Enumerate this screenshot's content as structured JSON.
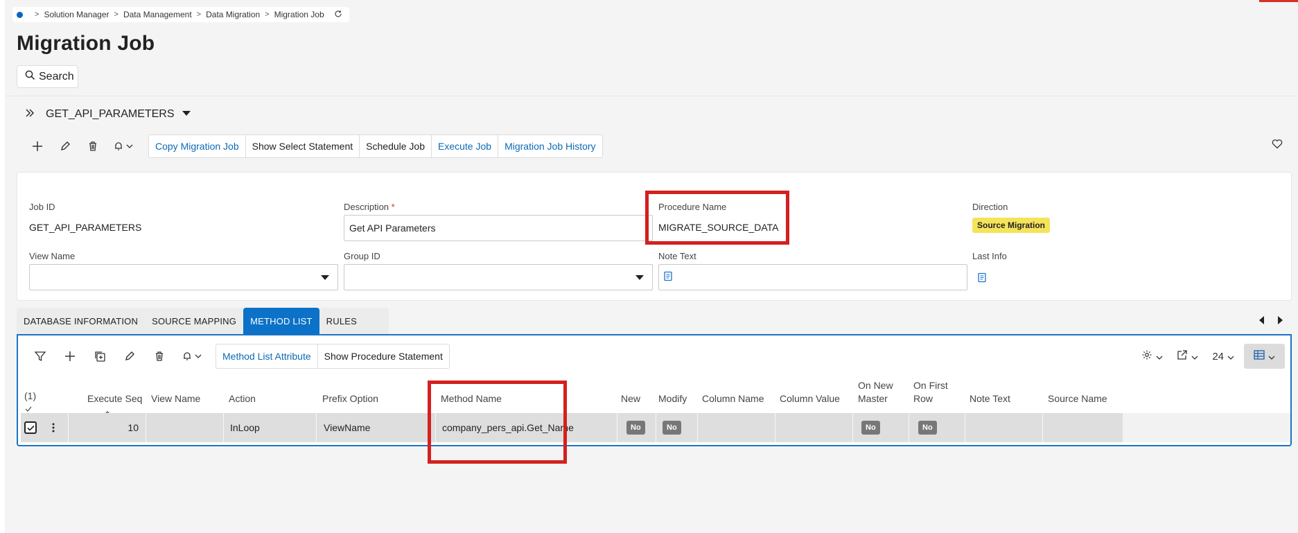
{
  "breadcrumb": {
    "items": [
      "Solution Manager",
      "Data Management",
      "Data Migration",
      "Migration Job"
    ],
    "separator": ">"
  },
  "page": {
    "title": "Migration Job",
    "search_label": "Search"
  },
  "record": {
    "title": "GET_API_PARAMETERS"
  },
  "toolbar": {
    "buttons": [
      "Copy Migration Job",
      "Show Select Statement",
      "Schedule Job",
      "Execute Job",
      "Migration Job History"
    ]
  },
  "form": {
    "job_id_label": "Job ID",
    "job_id_value": "GET_API_PARAMETERS",
    "description_label": "Description",
    "description_required": "*",
    "description_value": "Get API Parameters",
    "procedure_name_label": "Procedure Name",
    "procedure_name_value": "MIGRATE_SOURCE_DATA",
    "direction_label": "Direction",
    "direction_value": "Source Migration",
    "view_name_label": "View Name",
    "group_id_label": "Group ID",
    "note_text_label": "Note Text",
    "last_info_label": "Last Info"
  },
  "tabs": [
    {
      "label": "DATABASE INFORMATION",
      "active": false
    },
    {
      "label": "SOURCE MAPPING",
      "active": false
    },
    {
      "label": "METHOD LIST",
      "active": true
    },
    {
      "label": "RULES",
      "active": false
    }
  ],
  "method_toolbar": {
    "buttons": [
      "Method List Attribute",
      "Show Procedure Statement"
    ],
    "page_size": "24"
  },
  "table": {
    "selection_count": "(1)",
    "columns": [
      "Execute Seq",
      "View Name",
      "Action",
      "Prefix Option",
      "Method Name",
      "New",
      "Modify",
      "Column Name",
      "Column Value",
      "On New Master",
      "On First Row",
      "Note Text",
      "Source Name"
    ],
    "rows": [
      {
        "execute_seq": "10",
        "view_name": "",
        "action": "InLoop",
        "prefix_option": "ViewName",
        "method_name": "company_pers_api.Get_Name",
        "new": "No",
        "modify": "No",
        "column_name": "",
        "column_value": "",
        "on_new_master": "No",
        "on_first_row": "No",
        "note_text": "",
        "source_name": ""
      }
    ]
  },
  "colors": {
    "accent": "#0b72c8",
    "link": "#0b6ab3",
    "highlight_box": "#d42020",
    "direction_badge": "#f5e35a"
  }
}
